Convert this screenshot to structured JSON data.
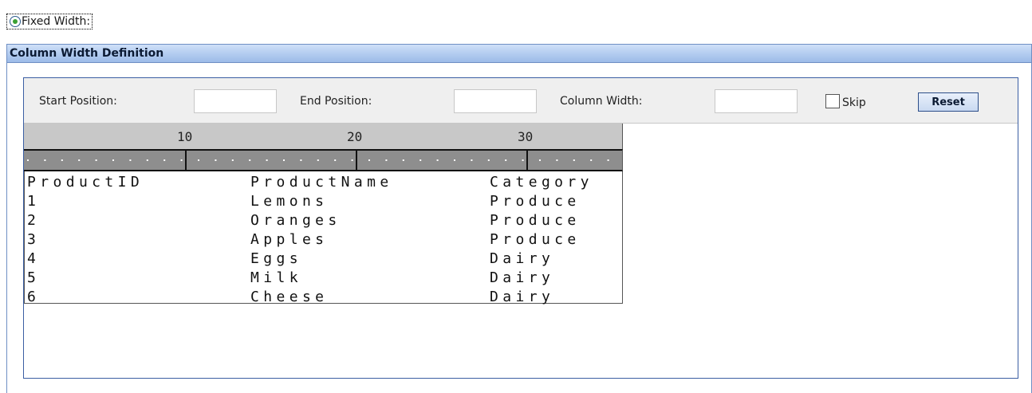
{
  "format_option": {
    "label": "Fixed Width:",
    "selected": true
  },
  "panel": {
    "title": "Column Width Definition"
  },
  "toolbar": {
    "start_label": "Start Position:",
    "start_value": "",
    "end_label": "End Position:",
    "end_value": "",
    "width_label": "Column Width:",
    "width_value": "",
    "skip_label": "Skip",
    "skip_checked": false,
    "reset_label": "Reset"
  },
  "ruler": {
    "marks": [
      "10",
      "20",
      "30"
    ]
  },
  "grid": {
    "rows": [
      [
        "ProductID",
        "ProductName",
        "Category"
      ],
      [
        "1",
        "Lemons",
        "Produce"
      ],
      [
        "2",
        "Oranges",
        "Produce"
      ],
      [
        "3",
        "Apples",
        "Produce"
      ],
      [
        "4",
        "Eggs",
        "Dairy"
      ],
      [
        "5",
        "Milk",
        "Dairy"
      ],
      [
        "6",
        "Cheese",
        "Dairy"
      ]
    ]
  },
  "colors": {
    "header_gradient_top": "#cfe0f8",
    "header_gradient_bottom": "#9dbbe8",
    "border_blue": "#3b5ea3",
    "radio_dot": "#3aa033",
    "ruler_numbers_bg": "#c8c8c8",
    "ruler_ticks_bg": "#8e8e8e"
  }
}
